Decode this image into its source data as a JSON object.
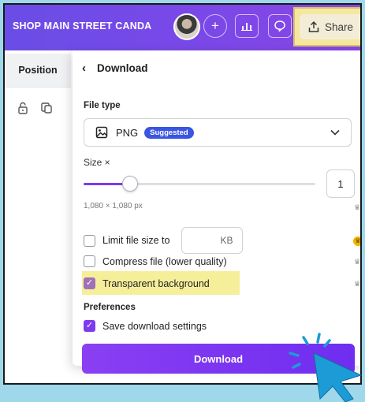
{
  "topbar": {
    "brand": "SHOP MAIN STREET CANDA",
    "share_label": "Share",
    "icons": [
      "plus-icon",
      "analytics-icon",
      "comment-icon",
      "share-upload-icon"
    ]
  },
  "left": {
    "position_tab": "Position"
  },
  "panel": {
    "title": "Download",
    "file_type_label": "File type",
    "file_type_value": "PNG",
    "file_type_badge": "Suggested",
    "size_label": "Size ×",
    "size_value": "1",
    "slider_fraction": 0.2,
    "dimensions": "1,080 × 1,080 px",
    "limit_size_label": "Limit file size to",
    "kb_unit": "KB",
    "compress_label": "Compress file (lower quality)",
    "transparent_label": "Transparent background",
    "preferences_label": "Preferences",
    "save_settings_label": "Save download settings",
    "download_button": "Download"
  },
  "colors": {
    "topbar": "#7048e8",
    "accent": "#7d3bf0",
    "highlight": "#f6ef9a",
    "background": "#9fd8ea"
  },
  "checkboxes": {
    "limit_size": false,
    "compress": false,
    "transparent": true,
    "save_settings": true
  }
}
